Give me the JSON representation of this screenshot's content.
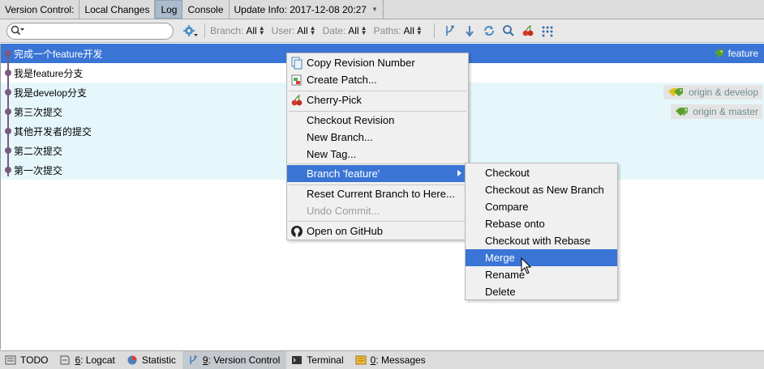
{
  "tabbar": {
    "label": "Version Control:",
    "tabs": [
      "Local Changes",
      "Log",
      "Console"
    ],
    "update_info": "Update Info: 2017-12-08 20:27"
  },
  "toolbar": {
    "search_placeholder": "",
    "filters": [
      {
        "name": "Branch:",
        "value": "All"
      },
      {
        "name": "User:",
        "value": "All"
      },
      {
        "name": "Date:",
        "value": "All"
      },
      {
        "name": "Paths:",
        "value": "All"
      }
    ]
  },
  "log": {
    "commits": [
      {
        "message": "完成一个feature开发",
        "ref": "feature"
      },
      {
        "message": "我是feature分支",
        "ref": ""
      },
      {
        "message": "我是develop分支",
        "ref": "origin & develop"
      },
      {
        "message": "第三次提交",
        "ref": "origin & master"
      },
      {
        "message": "其他开发者的提交",
        "ref": ""
      },
      {
        "message": "第二次提交",
        "ref": ""
      },
      {
        "message": "第一次提交",
        "ref": ""
      }
    ]
  },
  "context_menu": {
    "items": {
      "copy_revision": "Copy Revision Number",
      "create_patch": "Create Patch...",
      "cherry_pick": "Cherry-Pick",
      "checkout_revision": "Checkout Revision",
      "new_branch": "New Branch...",
      "new_tag": "New Tag...",
      "branch_feature": "Branch 'feature'",
      "reset_branch": "Reset Current Branch to Here...",
      "undo_commit": "Undo Commit...",
      "open_github": "Open on GitHub"
    }
  },
  "submenu": {
    "items": [
      "Checkout",
      "Checkout as New Branch",
      "Compare",
      "Rebase onto",
      "Checkout with Rebase",
      "Merge",
      "Rename",
      "Delete"
    ]
  },
  "bottombar": {
    "tabs": [
      {
        "prefix": "",
        "label": "TODO"
      },
      {
        "prefix": "6",
        "label": ": Logcat"
      },
      {
        "prefix": "",
        "label": "Statistic"
      },
      {
        "prefix": "9",
        "label": ": Version Control"
      },
      {
        "prefix": "",
        "label": "Terminal"
      },
      {
        "prefix": "0",
        "label": ": Messages"
      }
    ]
  },
  "colors": {
    "selection": "#3a75d5",
    "highlight_row": "#e6f7fb",
    "graph": "#7a5a7e",
    "tag_green": "#5aa02c",
    "tag_yellow": "#e0c020"
  },
  "icons": [
    "search-icon",
    "settings-icon",
    "cherry-icon",
    "github-icon",
    "copy-icon",
    "patch-icon",
    "tag-icon"
  ]
}
